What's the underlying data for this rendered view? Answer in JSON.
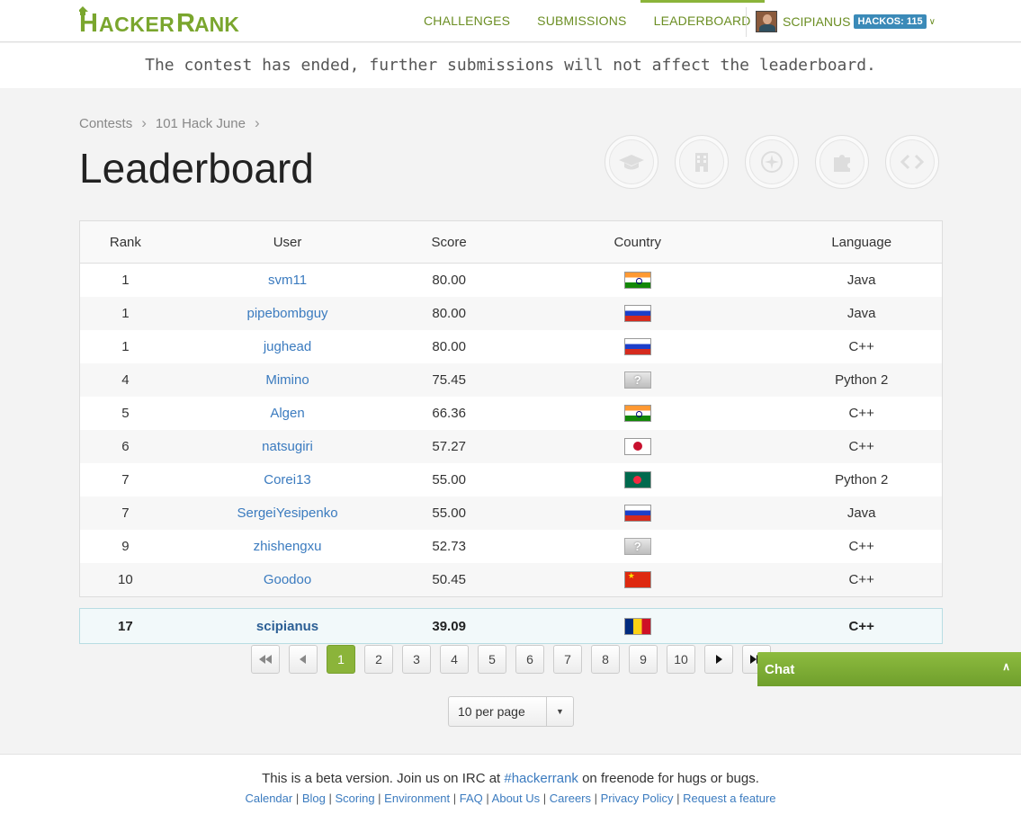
{
  "header": {
    "brand": "HackerRank",
    "nav": [
      "CHALLENGES",
      "SUBMISSIONS",
      "LEADERBOARD"
    ],
    "active_nav": "LEADERBOARD",
    "username": "SCIPIANUS",
    "hackos": "HACKOS: 115",
    "accent": "#8bb43a",
    "nav_color": "#6b8e23"
  },
  "banner": "The contest has ended, further submissions will not affect the leaderboard.",
  "breadcrumb": [
    "Contests",
    "101 Hack June"
  ],
  "title": "Leaderboard",
  "badges": [
    "graduation-cap-icon",
    "building-icon",
    "compass-icon",
    "puzzle-icon",
    "code-icon"
  ],
  "table": {
    "columns": [
      "Rank",
      "User",
      "Score",
      "Country",
      "Language"
    ],
    "rows": [
      {
        "rank": "1",
        "user": "svm11",
        "score": "80.00",
        "flag": "in",
        "lang": "Java"
      },
      {
        "rank": "1",
        "user": "pipebombguy",
        "score": "80.00",
        "flag": "ru",
        "lang": "Java"
      },
      {
        "rank": "1",
        "user": "jughead",
        "score": "80.00",
        "flag": "ru",
        "lang": "C++"
      },
      {
        "rank": "4",
        "user": "Mimino",
        "score": "75.45",
        "flag": "unk",
        "lang": "Python 2"
      },
      {
        "rank": "5",
        "user": "Algen",
        "score": "66.36",
        "flag": "in",
        "lang": "C++"
      },
      {
        "rank": "6",
        "user": "natsugiri",
        "score": "57.27",
        "flag": "jp",
        "lang": "C++"
      },
      {
        "rank": "7",
        "user": "Corei13",
        "score": "55.00",
        "flag": "bd",
        "lang": "Python 2"
      },
      {
        "rank": "7",
        "user": "SergeiYesipenko",
        "score": "55.00",
        "flag": "ru",
        "lang": "Java"
      },
      {
        "rank": "9",
        "user": "zhishengxu",
        "score": "52.73",
        "flag": "unk",
        "lang": "C++"
      },
      {
        "rank": "10",
        "user": "Goodoo",
        "score": "50.45",
        "flag": "cn",
        "lang": "C++"
      }
    ],
    "my_row": {
      "rank": "17",
      "user": "scipianus",
      "score": "39.09",
      "flag": "ro",
      "lang": "C++"
    }
  },
  "pagination": {
    "pages": [
      "1",
      "2",
      "3",
      "4",
      "5",
      "6",
      "7",
      "8",
      "9",
      "10"
    ],
    "current": "1"
  },
  "per_page": "10 per page",
  "chat": "Chat",
  "footer": {
    "line1_pre": "This is a beta version. Join us on IRC at ",
    "irc": "#hackerrank",
    "line1_post": " on freenode for hugs or bugs.",
    "links": [
      "Calendar",
      "Blog",
      "Scoring",
      "Environment",
      "FAQ",
      "About Us",
      "Careers",
      "Privacy Policy",
      "Request a feature"
    ]
  }
}
